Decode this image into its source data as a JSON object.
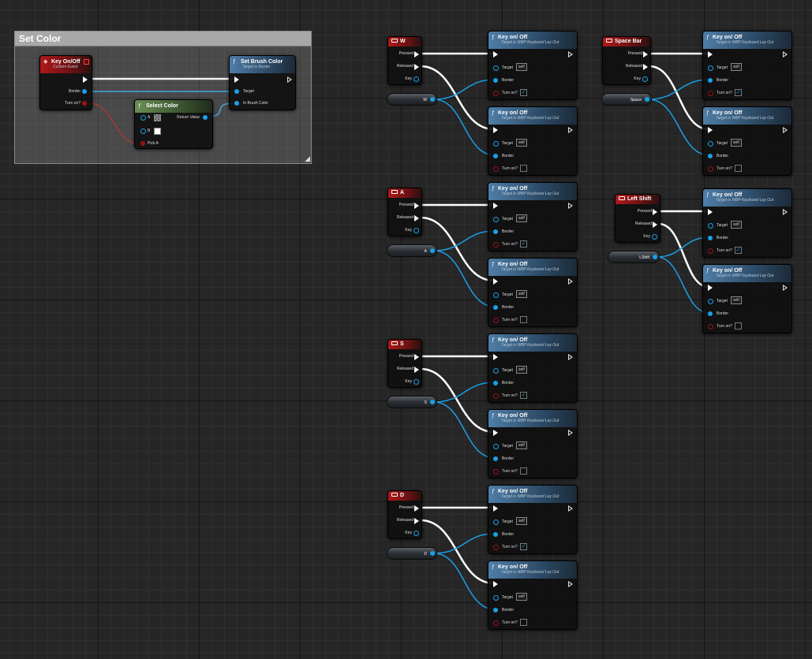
{
  "comment": {
    "title": "Set Color"
  },
  "event_node": {
    "title": "Key On/Off",
    "subtitle": "Custom Event",
    "border_label": "Border",
    "turn_on_label": "Turn on?"
  },
  "select_node": {
    "title": "Select Color",
    "a_label": "A",
    "b_label": "B",
    "pick_label": "Pick A",
    "return_label": "Return Value"
  },
  "brush_node": {
    "title": "Set Brush Color",
    "subtitle": "Target is Border",
    "target_label": "Target",
    "color_label": "In Brush Color"
  },
  "key_events": [
    {
      "key": "W",
      "pressed": "Pressed",
      "released": "Released",
      "key_label": "Key",
      "var_label": "W"
    },
    {
      "key": "A",
      "pressed": "Pressed",
      "released": "Released",
      "key_label": "Key",
      "var_label": "A"
    },
    {
      "key": "S",
      "pressed": "Pressed",
      "released": "Released",
      "key_label": "Key",
      "var_label": "S"
    },
    {
      "key": "D",
      "pressed": "Pressed",
      "released": "Released",
      "key_label": "Key",
      "var_label": "D"
    },
    {
      "key": "Space Bar",
      "pressed": "Pressed",
      "released": "Released",
      "key_label": "Key",
      "var_label": "Space"
    },
    {
      "key": "Left Shift",
      "pressed": "Pressed",
      "released": "Released",
      "key_label": "Key",
      "var_label": "LShift"
    }
  ],
  "call_node": {
    "title": "Key on/ Off",
    "subtitle": "Target is WBP Keyboard Lay Out",
    "target_label": "Target",
    "target_value": "self",
    "border_label": "Border",
    "turn_on_label": "Turn on?"
  },
  "calls": [
    {
      "turn_on": true
    },
    {
      "turn_on": false
    },
    {
      "turn_on": true
    },
    {
      "turn_on": false
    },
    {
      "turn_on": true
    },
    {
      "turn_on": false
    },
    {
      "turn_on": true
    },
    {
      "turn_on": false
    },
    {
      "turn_on": true
    },
    {
      "turn_on": false
    },
    {
      "turn_on": true
    },
    {
      "turn_on": false
    }
  ],
  "colors": {
    "exec": "#ffffff",
    "object_pin": "#1aa0e8",
    "bool_pin": "#9a1212",
    "event_header": "#b01818",
    "function_header": "#4f7ea8",
    "pure_header": "#6b8f56"
  },
  "icons": {
    "event": "event-diamond-icon",
    "function": "function-f-icon",
    "keyboard": "keyboard-icon",
    "check": "checkmark-icon"
  }
}
